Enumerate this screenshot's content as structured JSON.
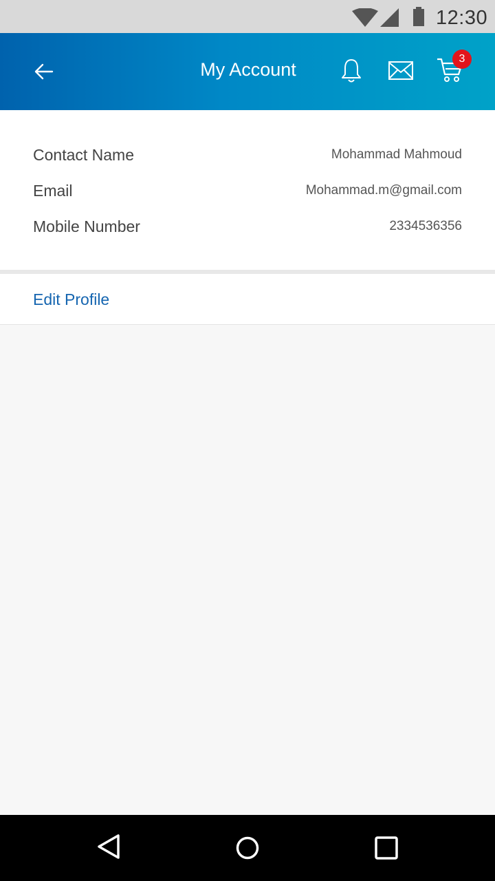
{
  "status_bar": {
    "time": "12:30",
    "icons": [
      "wifi-icon",
      "signal-icon",
      "battery-icon"
    ]
  },
  "app_bar": {
    "title": "My Account",
    "icons": [
      "back-arrow-icon",
      "bell-icon",
      "mail-icon",
      "cart-icon"
    ],
    "cart_count": "3",
    "colors": {
      "gradient_start": "#0062ad",
      "gradient_end": "#00a2c8",
      "badge": "#e2141b"
    }
  },
  "account": {
    "contact_name": {
      "label": "Contact Name",
      "value": "Mohammad Mahmoud"
    },
    "email": {
      "label": "Email",
      "value": "Mohammad.m@gmail.com"
    },
    "mobile": {
      "label": "Mobile Number",
      "value": "2334536356"
    }
  },
  "actions": {
    "edit_profile": "Edit Profile",
    "link_color": "#1565b0"
  },
  "nav_bar": {
    "icons": [
      "nav-back-icon",
      "nav-home-icon",
      "nav-recents-icon"
    ]
  }
}
